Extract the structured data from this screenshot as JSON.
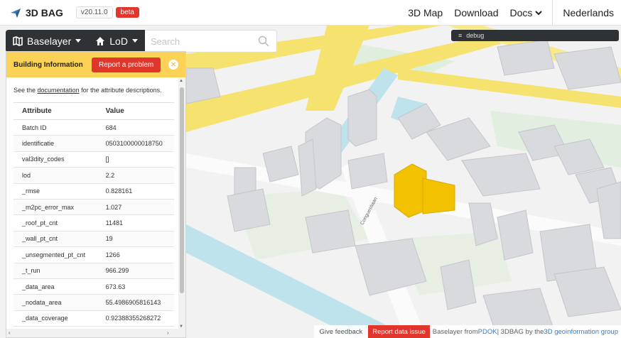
{
  "navbar": {
    "brand": "3D BAG",
    "version": "v20.11.0",
    "beta": "beta",
    "links": [
      "3D Map",
      "Download",
      "Docs"
    ],
    "language": "Nederlands"
  },
  "toolbar": {
    "baselayer": "Baselayer",
    "lod": "LoD",
    "search_placeholder": "Search"
  },
  "debug": {
    "label": "debug"
  },
  "panel": {
    "title": "Building Information",
    "report_button": "Report a problem",
    "doc_prefix": "See the ",
    "doc_link": "documentation",
    "doc_suffix": " for the attribute descriptions.",
    "columns": [
      "Attribute",
      "Value"
    ],
    "rows": [
      [
        "Batch ID",
        "684"
      ],
      [
        "identificatie",
        "0503100000018750"
      ],
      [
        "val3dity_codes",
        "[]"
      ],
      [
        "lod",
        "2.2"
      ],
      [
        "_rmse",
        "0.828161"
      ],
      [
        "_m2pc_error_max",
        "1.027"
      ],
      [
        "_roof_pt_cnt",
        "11481"
      ],
      [
        "_wall_pt_cnt",
        "19"
      ],
      [
        "_unsegmented_pt_cnt",
        "1266"
      ],
      [
        "_t_run",
        "966.299"
      ],
      [
        "_data_area",
        "673.63"
      ],
      [
        "_nodata_area",
        "55.4986905816143"
      ],
      [
        "_data_coverage",
        "0.92388355268272"
      ]
    ]
  },
  "map": {
    "street_label": "Conguestiaan"
  },
  "footer": {
    "feedback": "Give feedback",
    "report": "Report data issue",
    "attrib_prefix": "Baselayer from ",
    "pdok": "PDOK",
    "attrib_mid": " | 3DBAG by the ",
    "group": "3D geoinformation group"
  },
  "colors": {
    "accent_red": "#e0362c",
    "panel_header": "#fbd256",
    "toolbar_dark": "#2f3235",
    "selected_building": "#f2c200",
    "road_yellow": "#f6e26f",
    "water_blue": "#bfe3ec"
  }
}
